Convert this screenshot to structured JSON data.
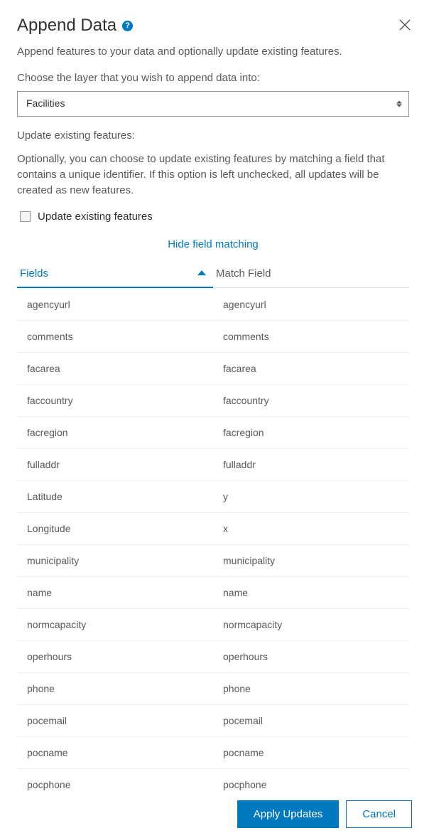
{
  "header": {
    "title": "Append Data",
    "helpGlyph": "?"
  },
  "intro": "Append features to your data and optionally update existing features.",
  "layerPrompt": "Choose the layer that you wish to append data into:",
  "layerSelect": {
    "selected": "Facilities"
  },
  "updateSection": {
    "heading": "Update existing features:",
    "description": "Optionally, you can choose to update existing features by matching a field that contains a unique identifier. If this option is left unchecked, all updates will be created as new features.",
    "checkboxLabel": "Update existing features",
    "checked": false
  },
  "toggleLink": "Hide field matching",
  "columns": {
    "fields": "Fields",
    "match": "Match Field"
  },
  "rows": [
    {
      "field": "agencyurl",
      "match": "agencyurl"
    },
    {
      "field": "comments",
      "match": "comments"
    },
    {
      "field": "facarea",
      "match": "facarea"
    },
    {
      "field": "faccountry",
      "match": "faccountry"
    },
    {
      "field": "facregion",
      "match": "facregion"
    },
    {
      "field": "fulladdr",
      "match": "fulladdr"
    },
    {
      "field": "Latitude",
      "match": "y"
    },
    {
      "field": "Longitude",
      "match": "x"
    },
    {
      "field": "municipality",
      "match": "municipality"
    },
    {
      "field": "name",
      "match": "name"
    },
    {
      "field": "normcapacity",
      "match": "normcapacity"
    },
    {
      "field": "operhours",
      "match": "operhours"
    },
    {
      "field": "phone",
      "match": "phone"
    },
    {
      "field": "pocemail",
      "match": "pocemail"
    },
    {
      "field": "pocname",
      "match": "pocname"
    },
    {
      "field": "pocphone",
      "match": "pocphone"
    }
  ],
  "footer": {
    "apply": "Apply Updates",
    "cancel": "Cancel"
  }
}
